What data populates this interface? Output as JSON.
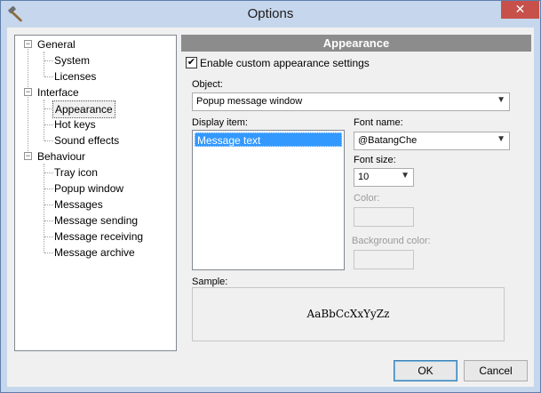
{
  "window": {
    "title": "Options",
    "app_icon": "hammer-icon",
    "close_glyph": "✕"
  },
  "tree": {
    "groups": [
      {
        "label": "General",
        "toggle": "−",
        "children": [
          "System",
          "Licenses"
        ]
      },
      {
        "label": "Interface",
        "toggle": "−",
        "children": [
          "Appearance",
          "Hot keys",
          "Sound effects"
        ]
      },
      {
        "label": "Behaviour",
        "toggle": "−",
        "children": [
          "Tray icon",
          "Popup window",
          "Messages",
          "Message sending",
          "Message receiving",
          "Message archive"
        ]
      }
    ],
    "selected": "Appearance"
  },
  "panel": {
    "header": "Appearance",
    "enable_custom": {
      "label": "Enable custom appearance settings",
      "checked": true,
      "mark": "✔"
    },
    "object": {
      "label": "Object:",
      "value": "Popup message window"
    },
    "display_item": {
      "label": "Display item:",
      "items": [
        "Message text"
      ],
      "selected": "Message text"
    },
    "font_name": {
      "label": "Font name:",
      "value": "@BatangChe"
    },
    "font_size": {
      "label": "Font size:",
      "value": "10"
    },
    "color": {
      "label": "Color:"
    },
    "background_color": {
      "label": "Background color:"
    },
    "sample": {
      "label": "Sample:",
      "text": "AaBbCcXxYyZz"
    }
  },
  "buttons": {
    "ok": "OK",
    "cancel": "Cancel"
  },
  "colors": {
    "title_bar": "#c6d6ec",
    "close": "#c7504b",
    "selection": "#3399ff",
    "header": "#8c8c8c"
  }
}
